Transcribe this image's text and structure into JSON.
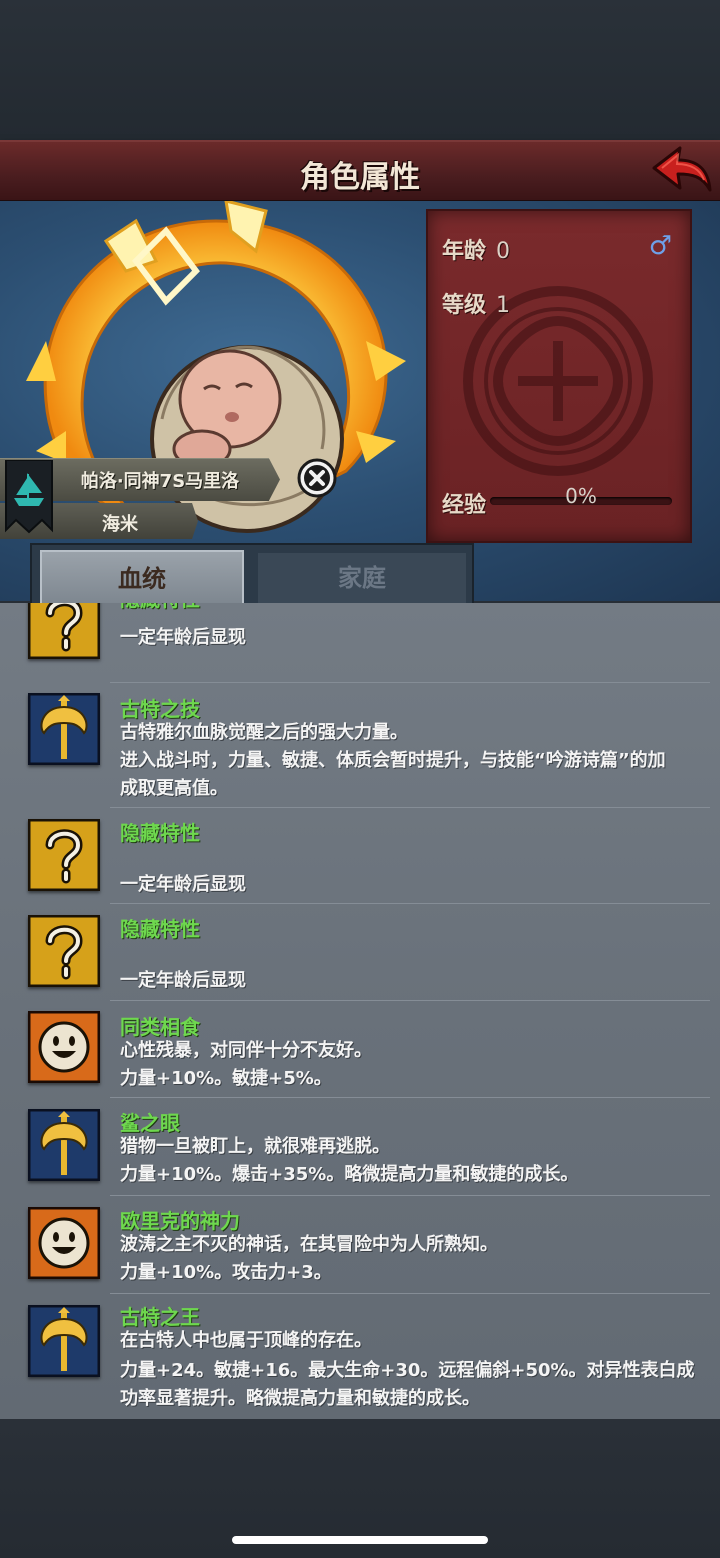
{
  "header": {
    "title": "角色属性",
    "back_icon": "back-arrow-icon"
  },
  "character": {
    "name": "帕洛·同神7S马里洛",
    "sub_name": "海米",
    "age_label": "年龄",
    "age_value": "0",
    "level_label": "等级",
    "level_value": "1",
    "exp_label": "经验",
    "exp_value": "0%",
    "gender_icon": "♂",
    "exp_progress": 0
  },
  "tabs": [
    {
      "label": "血统",
      "active": true
    },
    {
      "label": "家庭",
      "active": false
    }
  ],
  "traits": [
    {
      "icon": "question-icon",
      "name": "隐藏特性",
      "lines": [
        "一定年龄后显现"
      ]
    },
    {
      "icon": "axe-icon",
      "name": "古特之技",
      "lines": [
        "古特雅尔血脉觉醒之后的强大力量。",
        "进入战斗时，力量、敏捷、体质会暂时提升，与技能“吟游诗篇”的加",
        "成取更高值。"
      ]
    },
    {
      "icon": "question-icon",
      "name": "隐藏特性",
      "lines": [
        "一定年龄后显现"
      ]
    },
    {
      "icon": "question-icon",
      "name": "隐藏特性",
      "lines": [
        "一定年龄后显现"
      ]
    },
    {
      "icon": "smile-icon",
      "name": "同类相食",
      "lines": [
        "心性残暴，对同伴十分不友好。",
        "力量+10%。敏捷+5%。"
      ]
    },
    {
      "icon": "axe-icon",
      "name": "鲨之眼",
      "lines": [
        "猎物一旦被盯上，就很难再逃脱。",
        "力量+10%。爆击+35%。略微提高力量和敏捷的成长。"
      ]
    },
    {
      "icon": "smile-icon",
      "name": "欧里克的神力",
      "lines": [
        "波涛之主不灭的神话，在其冒险中为人所熟知。",
        "力量+10%。攻击力+3。"
      ]
    },
    {
      "icon": "axe-icon",
      "name": "古特之王",
      "lines": [
        "在古特人中也属于顶峰的存在。",
        "力量+24。敏捷+16。最大生命+30。远程偏斜+50%。对异性表白成",
        "功率显著提升。略微提高力量和敏捷的成长。"
      ]
    }
  ],
  "colors": {
    "trait_name": "#6ed84e",
    "title_bar": "#5a2224",
    "stats_panel": "#7a2a2c"
  }
}
